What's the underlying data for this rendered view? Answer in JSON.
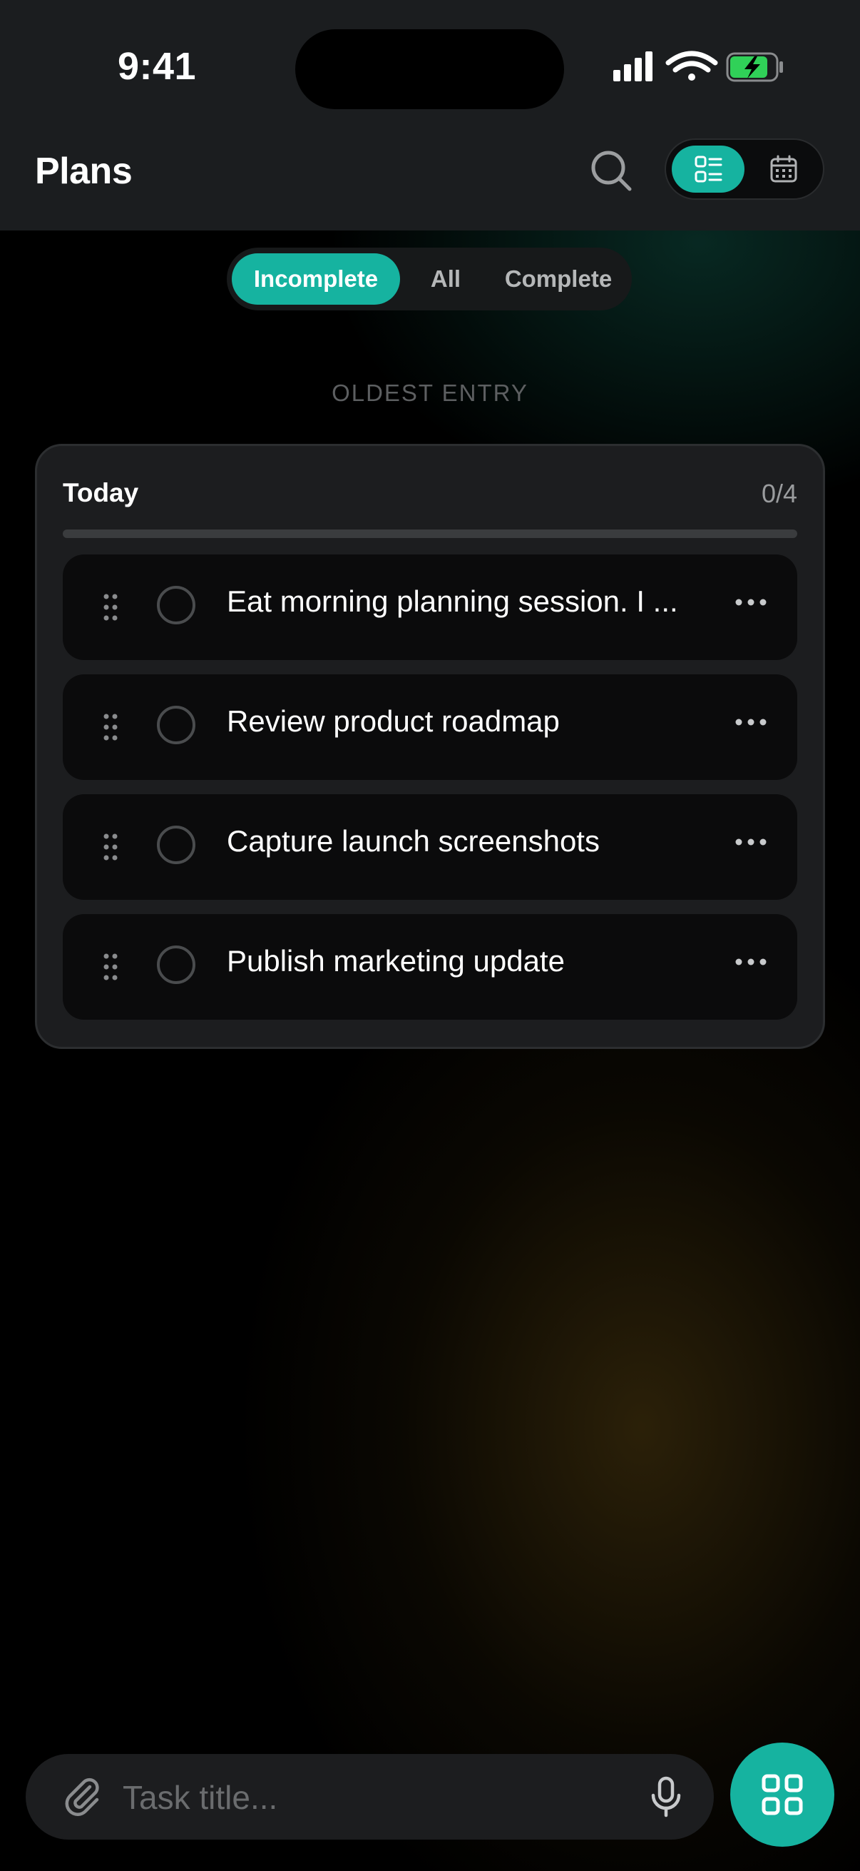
{
  "status_bar": {
    "time": "9:41",
    "icons": [
      "cellular-signal-icon",
      "wifi-icon",
      "battery-charging-icon"
    ],
    "battery_color": "#30d158"
  },
  "header": {
    "title": "Plans",
    "search_icon": "search-icon",
    "view_toggle": {
      "selected": "list",
      "options": [
        "list-view-icon",
        "calendar-view-icon"
      ]
    }
  },
  "filters": {
    "selected": "Incomplete",
    "options": [
      "Incomplete",
      "All",
      "Complete"
    ]
  },
  "section_label": "OLDEST ENTRY",
  "group": {
    "title": "Today",
    "count": "0/4",
    "progress": 0,
    "tasks": [
      {
        "text": "Eat morning planning session. I ...",
        "done": false
      },
      {
        "text": "Review product roadmap",
        "done": false
      },
      {
        "text": "Capture launch screenshots",
        "done": false
      },
      {
        "text": "Publish marketing update",
        "done": false
      }
    ]
  },
  "composer": {
    "placeholder": "Task title...",
    "attach_icon": "paperclip-icon",
    "mic_icon": "microphone-icon"
  },
  "fab_icon": "grid-icon",
  "colors": {
    "accent": "#16b3a0",
    "background": "#000000",
    "surface": "#1c1d1f"
  }
}
